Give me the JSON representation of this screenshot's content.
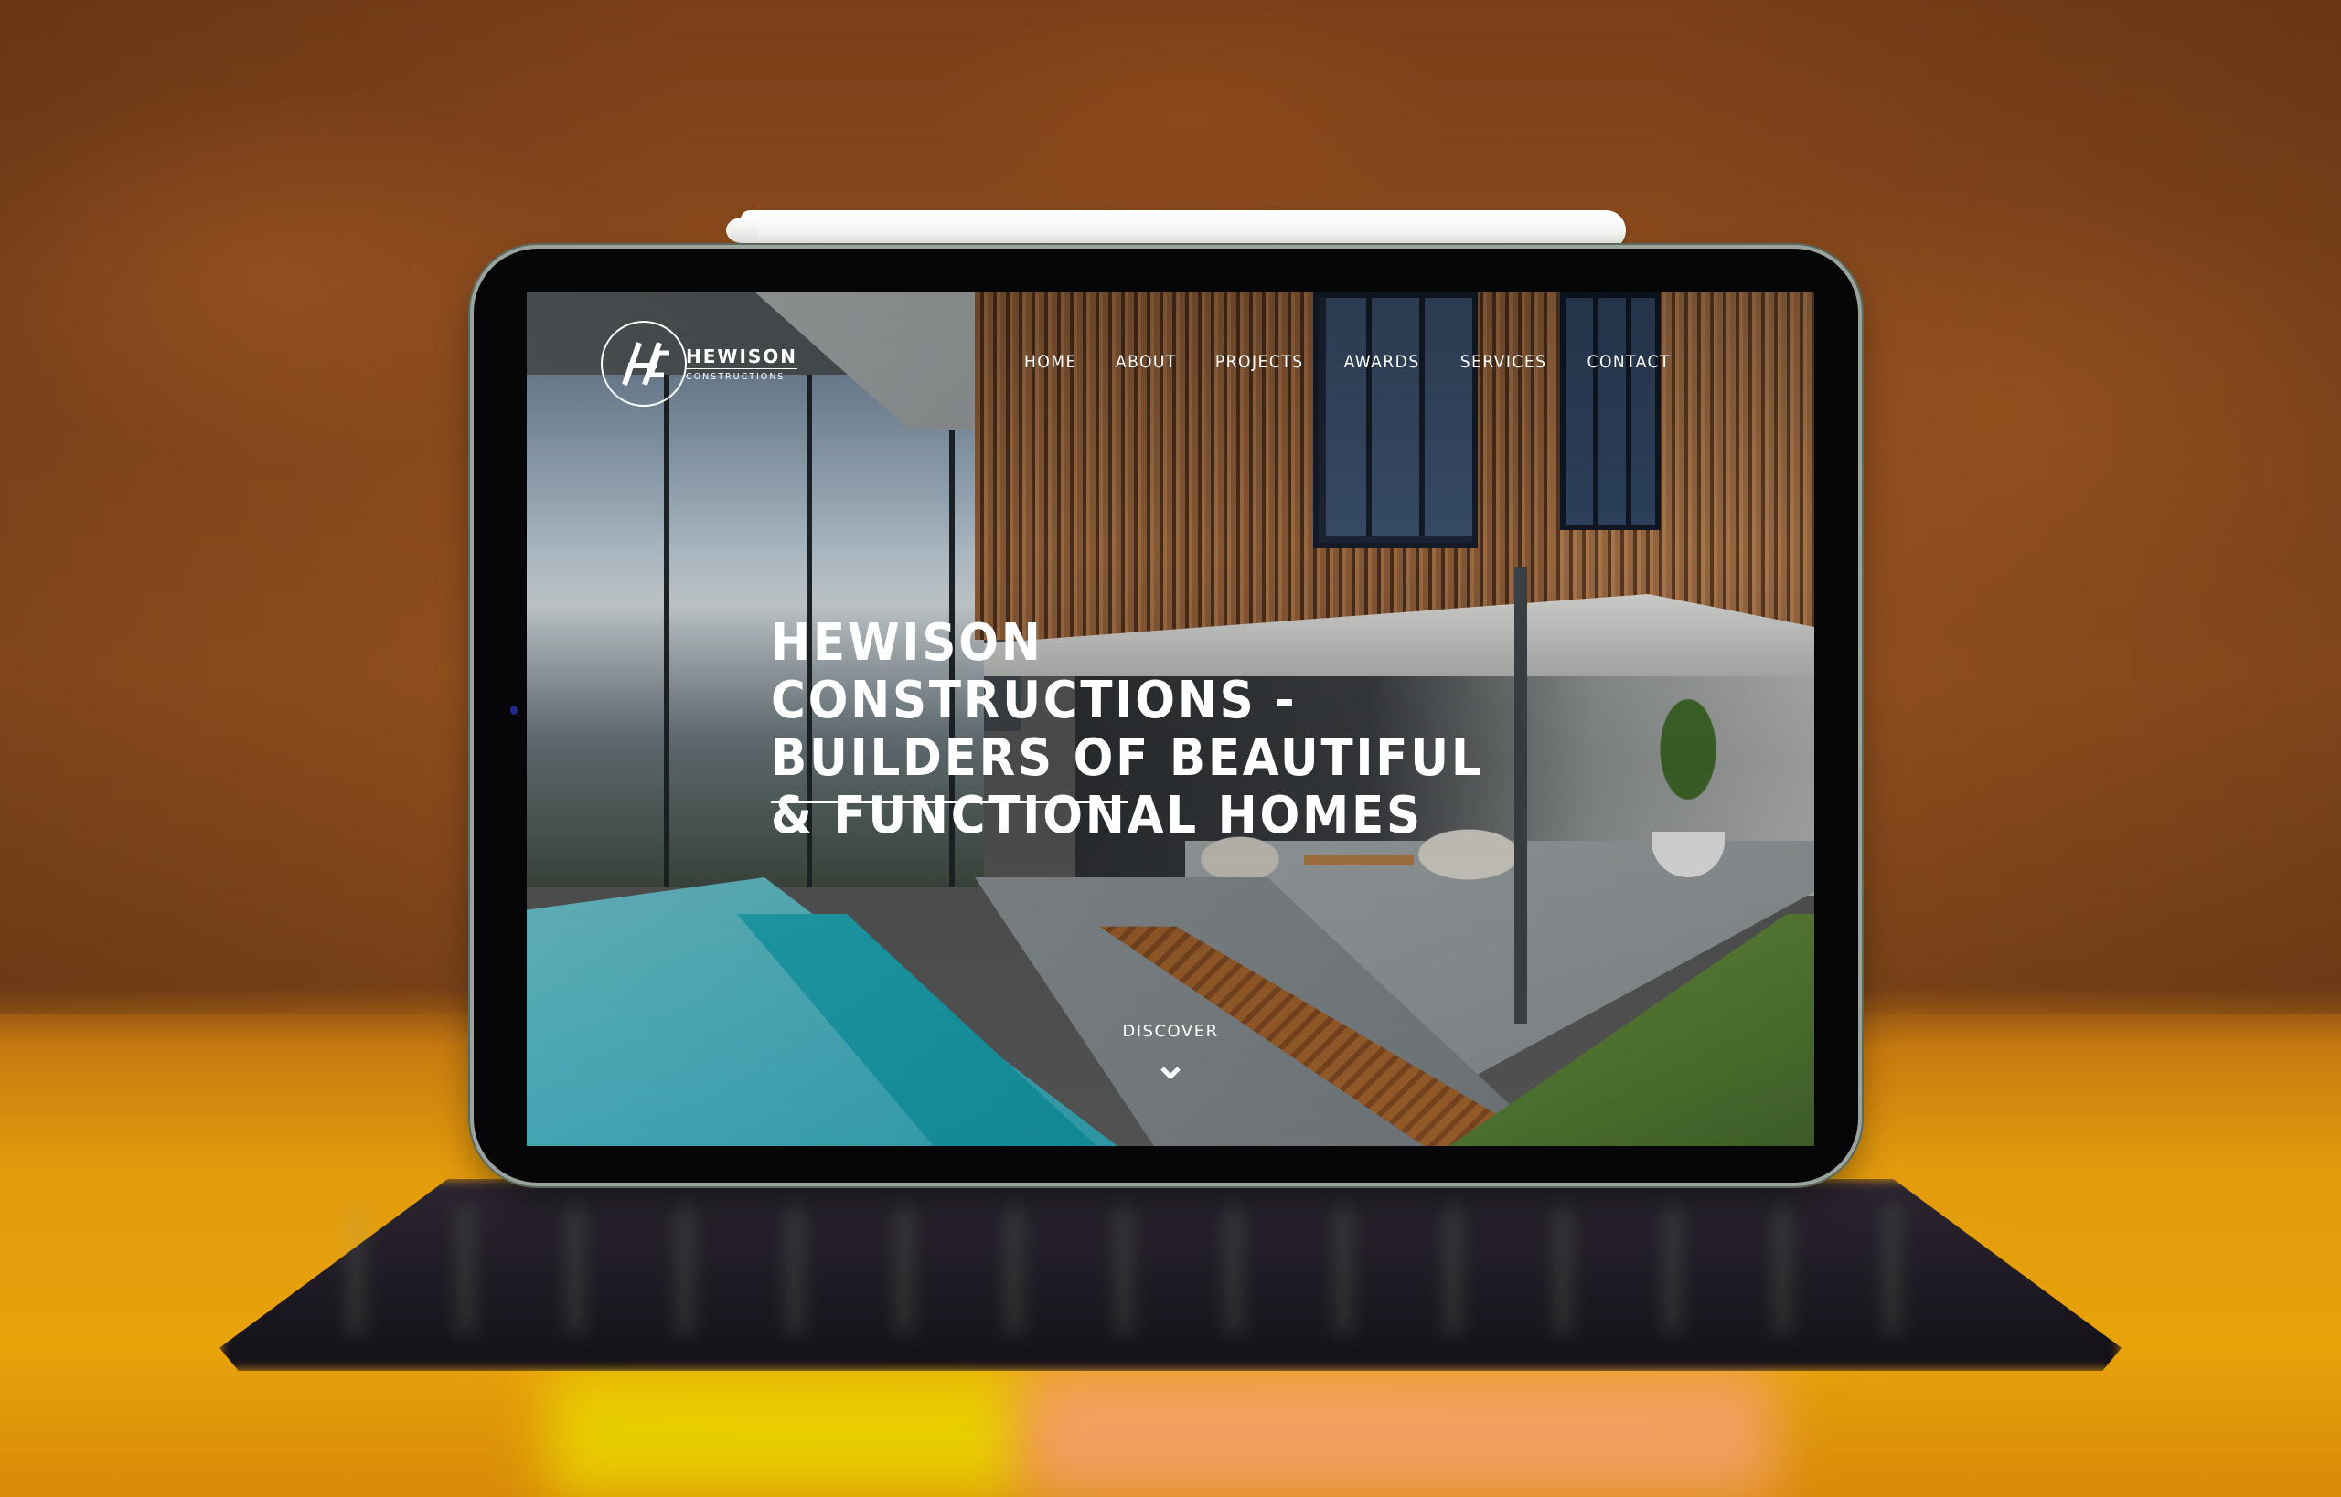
{
  "site": {
    "brand_name": "HEWISON",
    "brand_sub": "CONSTRUCTIONS",
    "logo_monogram": "HC",
    "nav": [
      {
        "label": "HOME"
      },
      {
        "label": "ABOUT"
      },
      {
        "label": "PROJECTS"
      },
      {
        "label": "AWARDS"
      },
      {
        "label": "SERVICES"
      },
      {
        "label": "CONTACT"
      }
    ],
    "hero": {
      "title": "HEWISON CONSTRUCTIONS -\nBUILDERS OF BEAUTIFUL\n& FUNCTIONAL HOMES"
    },
    "scroll_cue": {
      "label": "DISCOVER",
      "icon": "chevron-down-icon"
    }
  },
  "scene": {
    "device": "tablet with keyboard and stylus",
    "colors": {
      "wall": "#8c4b1d",
      "table": "#e39a0c",
      "bezel": "#060608",
      "text": "#ffffff"
    }
  }
}
